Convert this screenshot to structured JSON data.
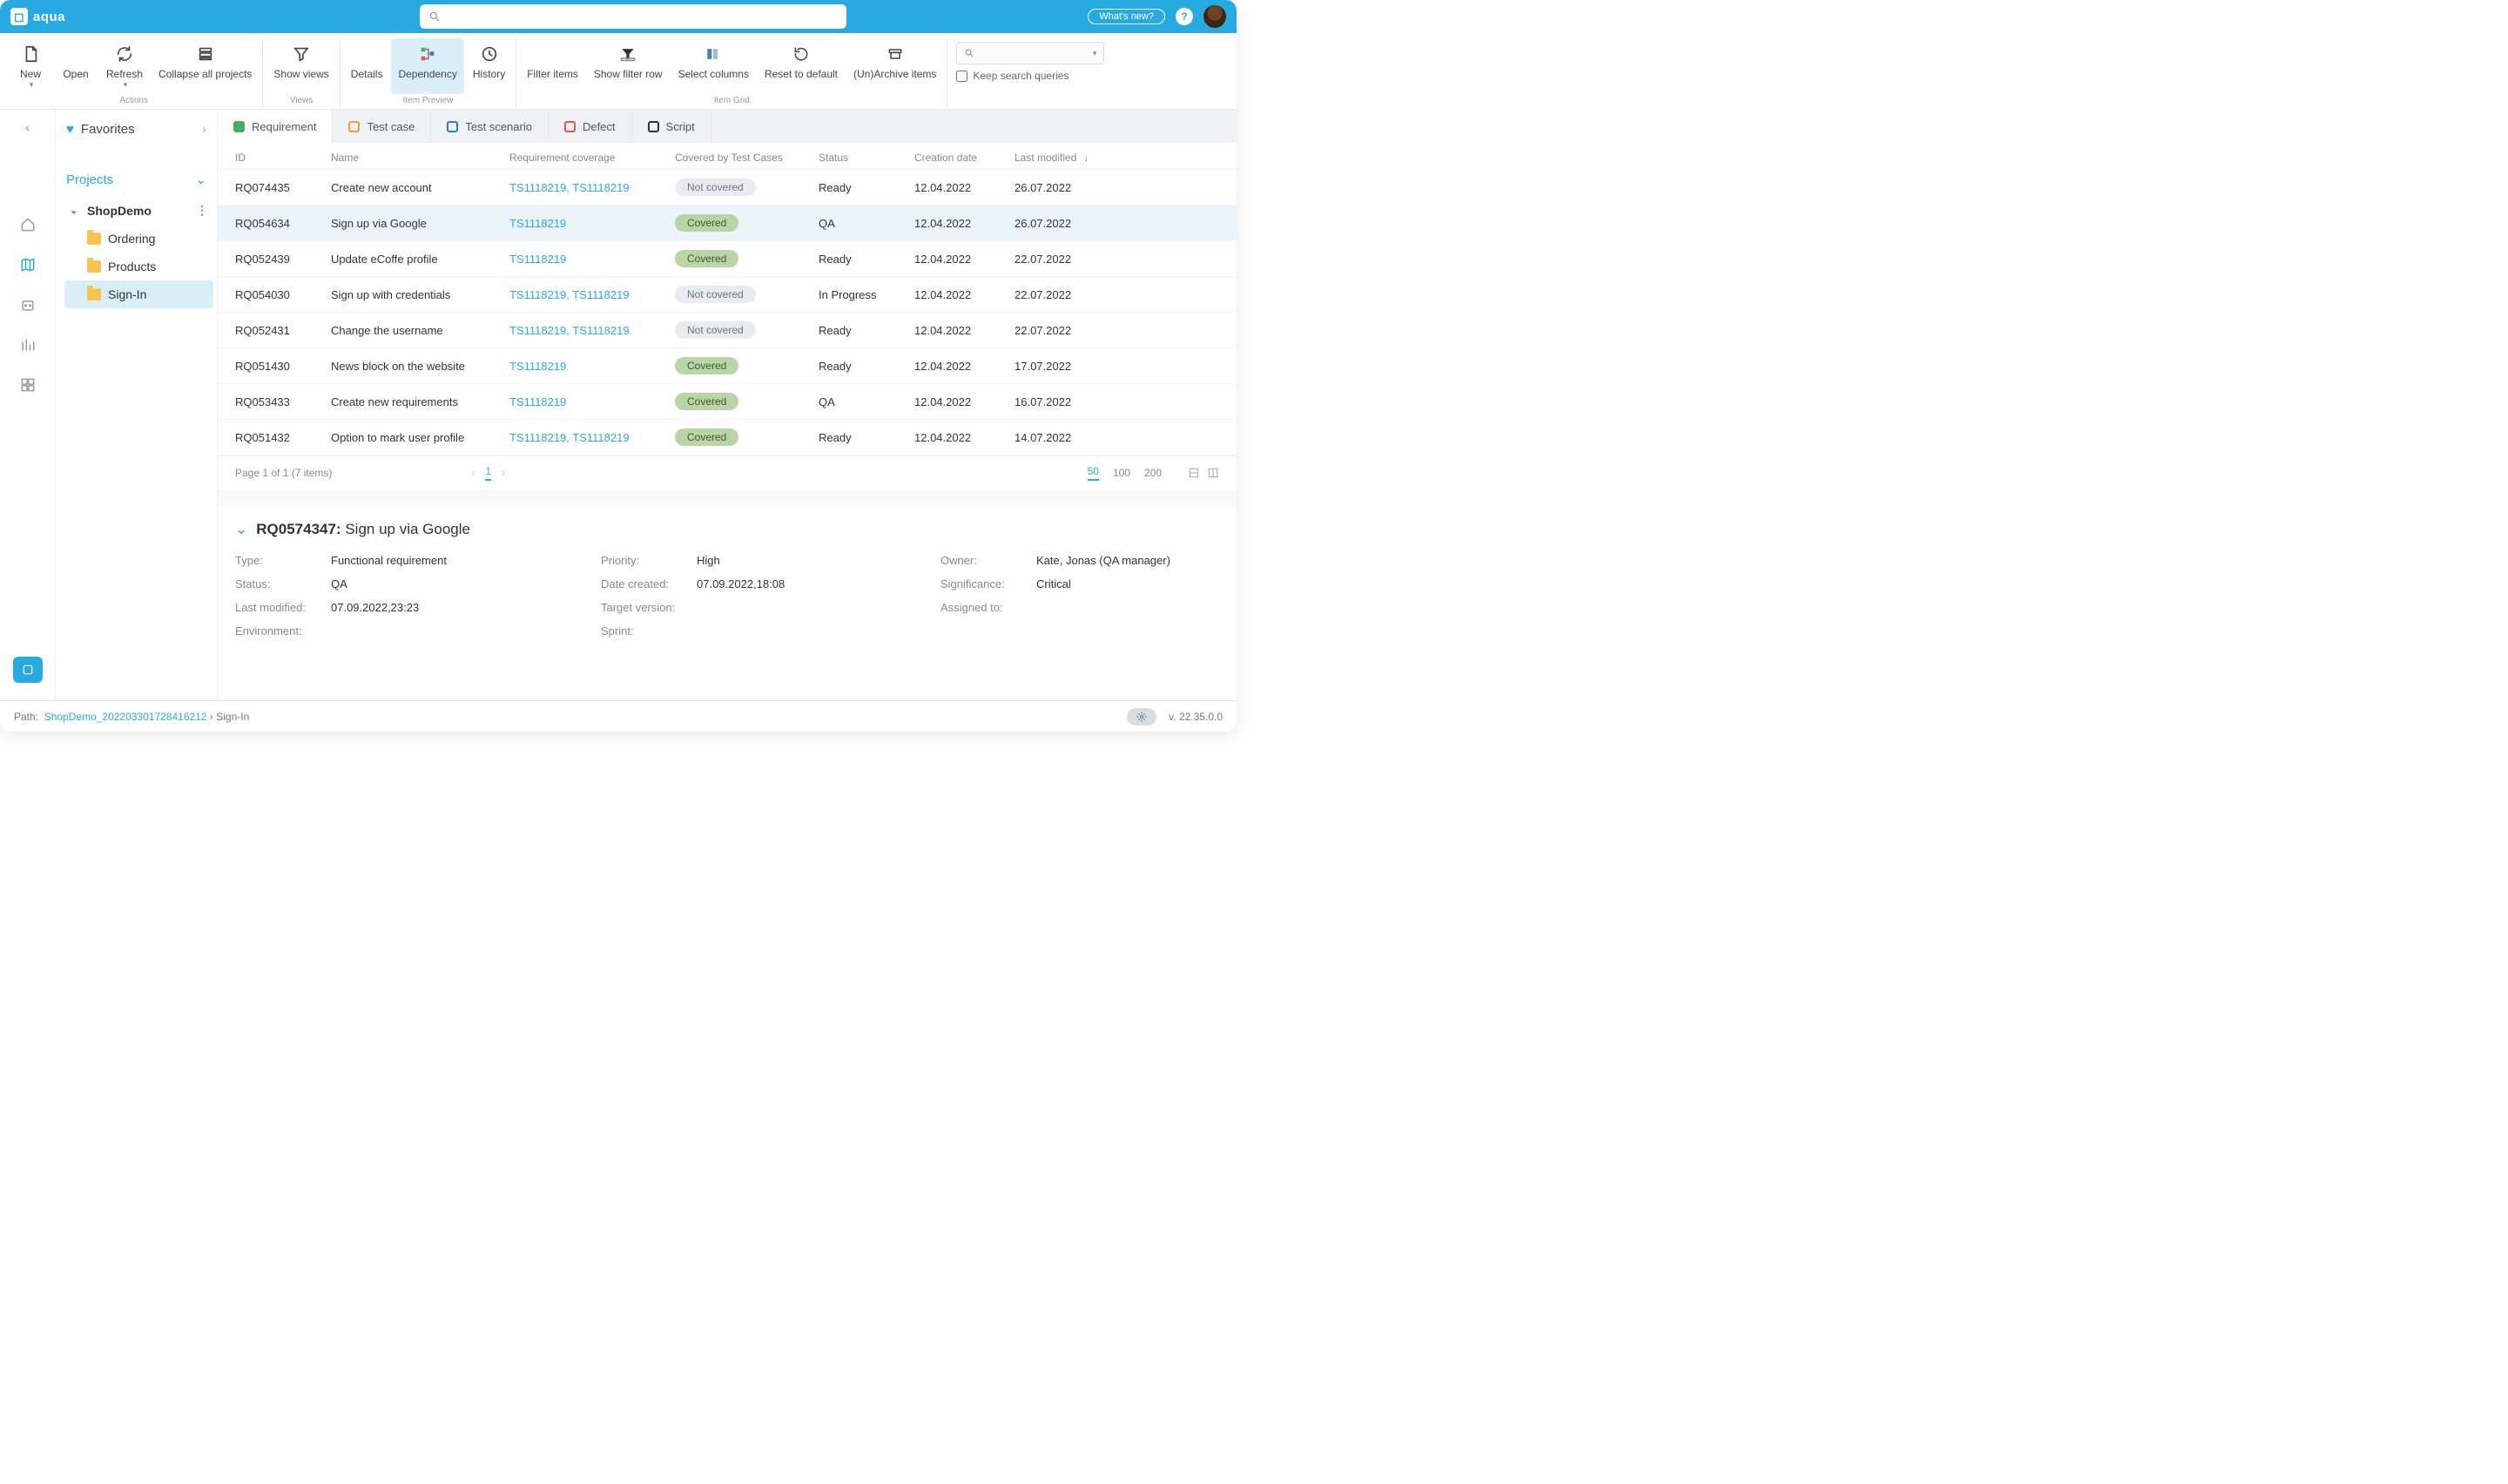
{
  "brand": "aqua",
  "topbar": {
    "whatsnew": "What's new?"
  },
  "ribbon": {
    "actions": {
      "label": "Actions",
      "new": "New",
      "open": "Open",
      "refresh": "Refresh",
      "collapse": "Collapse all projects"
    },
    "views": {
      "label": "Views",
      "show": "Show views"
    },
    "preview": {
      "label": "Item Preview",
      "details": "Details",
      "dependency": "Dependency",
      "history": "History"
    },
    "grid": {
      "label": "Item Grid",
      "filter": "Filter items",
      "filterrow": "Show filter row",
      "selectcols": "Select columns",
      "reset": "Reset to default",
      "archive": "(Un)Archive items"
    },
    "keep": "Keep search queries"
  },
  "sidebar": {
    "favorites": "Favorites",
    "projects": "Projects",
    "project": "ShopDemo",
    "folders": [
      "Ordering",
      "Products",
      "Sign-In"
    ]
  },
  "tabs": [
    "Requirement",
    "Test case",
    "Test scenario",
    "Defect",
    "Script"
  ],
  "columns": [
    "ID",
    "Name",
    "Requirement coverage",
    "Covered by Test Cases",
    "Status",
    "Creation date",
    "Last modified"
  ],
  "rows": [
    {
      "id": "RQ074435",
      "name": "Create new account",
      "cov": "TS1118219, TS1118219",
      "covered": "Not covered",
      "status": "Ready",
      "created": "12.04.2022",
      "modified": "26.07.2022"
    },
    {
      "id": "RQ054634",
      "name": "Sign up via Google",
      "cov": "TS1118219",
      "covered": "Covered",
      "status": "QA",
      "created": "12.04.2022",
      "modified": "26.07.2022",
      "selected": true
    },
    {
      "id": "RQ052439",
      "name": "Update eCoffe profile",
      "cov": "TS1118219",
      "covered": "Covered",
      "status": "Ready",
      "created": "12.04.2022",
      "modified": "22.07.2022"
    },
    {
      "id": "RQ054030",
      "name": "Sign up with credentials",
      "cov": "TS1118219, TS1118219",
      "covered": "Not covered",
      "status": "In Progress",
      "created": "12.04.2022",
      "modified": "22.07.2022"
    },
    {
      "id": "RQ052431",
      "name": "Change the username",
      "cov": "TS1118219, TS1118219",
      "covered": "Not covered",
      "status": "Ready",
      "created": "12.04.2022",
      "modified": "22.07.2022"
    },
    {
      "id": "RQ051430",
      "name": "News block on the website",
      "cov": "TS1118219",
      "covered": "Covered",
      "status": "Ready",
      "created": "12.04.2022",
      "modified": "17.07.2022"
    },
    {
      "id": "RQ053433",
      "name": "Create new requirements",
      "cov": "TS1118219",
      "covered": "Covered",
      "status": "QA",
      "created": "12.04.2022",
      "modified": "16.07.2022"
    },
    {
      "id": "RQ051432",
      "name": "Option to mark user profile",
      "cov": "TS1118219, TS1118219",
      "covered": "Covered",
      "status": "Ready",
      "created": "12.04.2022",
      "modified": "14.07.2022"
    }
  ],
  "pager": {
    "summary": "Page 1 of 1 (7 items)",
    "page": "1",
    "sizes": [
      "50",
      "100",
      "200"
    ]
  },
  "detail": {
    "title_id": "RQ0574347",
    "title_name": "Sign up via Google",
    "labels": {
      "type": "Type:",
      "status": "Status:",
      "lastmod": "Last modified:",
      "env": "Environment:",
      "prio": "Priority:",
      "created": "Date created:",
      "target": "Target version:",
      "sprint": "Sprint:",
      "owner": "Owner:",
      "sig": "Significance:",
      "assigned": "Assigned to:"
    },
    "type": "Functional requirement",
    "status": "QA",
    "lastmod": "07.09.2022,23:23",
    "env": "",
    "prio": "High",
    "created": "07.09.2022,18:08",
    "target": "",
    "sprint": "",
    "owner": "Kate, Jonas (QA manager)",
    "sig": "Critical",
    "assigned": ""
  },
  "statusbar": {
    "path_label": "Path:",
    "path_link": "ShopDemo_202203301728416212",
    "path_tail": "Sign-In",
    "version": "v. 22.35.0.0"
  }
}
